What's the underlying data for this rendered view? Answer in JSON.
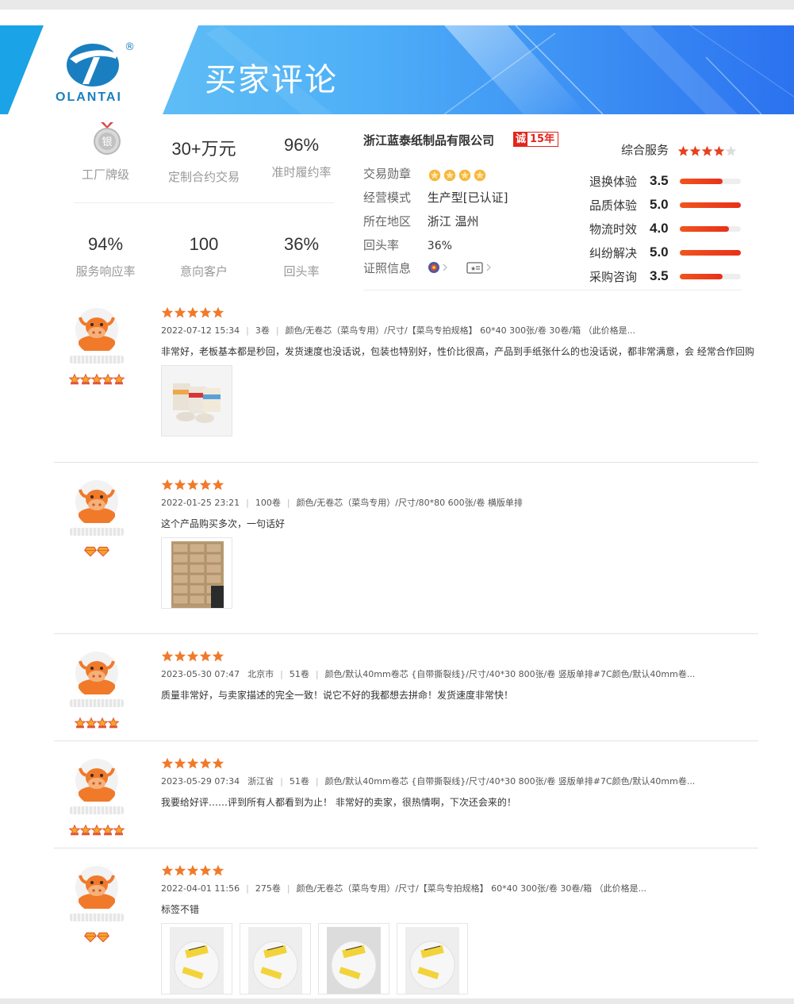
{
  "banner": {
    "brand": "OLANTAI",
    "registered_mark": "®",
    "title": "买家评论"
  },
  "factory": {
    "medal_char": "银",
    "medal_label": "工厂牌级",
    "stats": [
      {
        "value": "30+万元",
        "label": "定制合约交易"
      },
      {
        "value": "96%",
        "label": "准时履约率"
      },
      {
        "value": "94%",
        "label": "服务响应率"
      },
      {
        "value": "100",
        "label": "意向客户"
      },
      {
        "value": "36%",
        "label": "回头率"
      }
    ]
  },
  "company": {
    "name": "浙江蓝泰纸制品有限公司",
    "badge_char": "诚",
    "years": "15年",
    "info": [
      {
        "key": "交易勋章",
        "value": "",
        "medal_count": 4
      },
      {
        "key": "经营模式",
        "value": "生产型[已认证]"
      },
      {
        "key": "所在地区",
        "value": "浙江 温州"
      },
      {
        "key": "回头率",
        "value": "36%"
      },
      {
        "key": "证照信息",
        "value": ""
      }
    ],
    "service": {
      "label": "综合服务",
      "stars": 4,
      "scores": [
        {
          "label": "退换体验",
          "value": "3.5",
          "fill": 0.7
        },
        {
          "label": "品质体验",
          "value": "5.0",
          "fill": 1.0
        },
        {
          "label": "物流时效",
          "value": "4.0",
          "fill": 0.8
        },
        {
          "label": "纠纷解决",
          "value": "5.0",
          "fill": 1.0
        },
        {
          "label": "采购咨询",
          "value": "3.5",
          "fill": 0.7
        }
      ]
    }
  },
  "reviews": [
    {
      "stars": 5,
      "level_icons": 5,
      "level_type": "crown",
      "date": "2022-07-12 15:34",
      "location": "",
      "quantity": "3卷",
      "spec": "颜色/无卷芯（菜鸟专用）/尺寸/【菜鸟专拍规格】 60*40 300张/卷 30卷/箱 （此价格是...",
      "content": "非常好，老板基本都是秒回，发货速度也没话说，包装也特别好，性价比很高，产品到手纸张什么的也没话说，都非常满意，会 经常合作回购",
      "photos": [
        "labels-rolls-photo"
      ]
    },
    {
      "stars": 5,
      "level_icons": 2,
      "level_type": "diamond",
      "date": "2022-01-25 23:21",
      "location": "",
      "quantity": "100卷",
      "spec": "颜色/无卷芯（菜鸟专用）/尺寸/80*80 600张/卷 横版单排",
      "content": "这个产品购买多次，一句话好",
      "photos": [
        "boxes-photo"
      ]
    },
    {
      "stars": 5,
      "level_icons": 4,
      "level_type": "crown",
      "date": "2023-05-30 07:47",
      "location": "北京市",
      "quantity": "51卷",
      "spec": "颜色/默认40mm卷芯 {自带撕裂线}/尺寸/40*30 800张/卷 竖版单排#7C颜色/默认40mm卷...",
      "content": "质量非常好，与卖家描述的完全一致！说它不好的我都想去拼命！发货速度非常快！",
      "photos": []
    },
    {
      "stars": 5,
      "level_icons": 5,
      "level_type": "crown",
      "date": "2023-05-29 07:34",
      "location": "浙江省",
      "quantity": "51卷",
      "spec": "颜色/默认40mm卷芯 {自带撕裂线}/尺寸/40*30 800张/卷 竖版单排#7C颜色/默认40mm卷...",
      "content": "我要给好评……评到所有人都看到为止！ 非常好的卖家，很热情啊，下次还会来的！",
      "photos": []
    },
    {
      "stars": 5,
      "level_icons": 2,
      "level_type": "diamond",
      "date": "2022-04-01 11:56",
      "location": "",
      "quantity": "275卷",
      "spec": "颜色/无卷芯（菜鸟专用）/尺寸/【菜鸟专拍规格】 60*40 300张/卷 30卷/箱 （此价格是...",
      "content": "标签不错",
      "photos": [
        "bag-photo-1",
        "bag-photo-2",
        "bag-photo-3",
        "bag-photo-4"
      ]
    }
  ],
  "colors": {
    "accent_orange": "#f07a2a",
    "brand_blue": "#1a7fc0",
    "badge_red": "#e2261c"
  }
}
